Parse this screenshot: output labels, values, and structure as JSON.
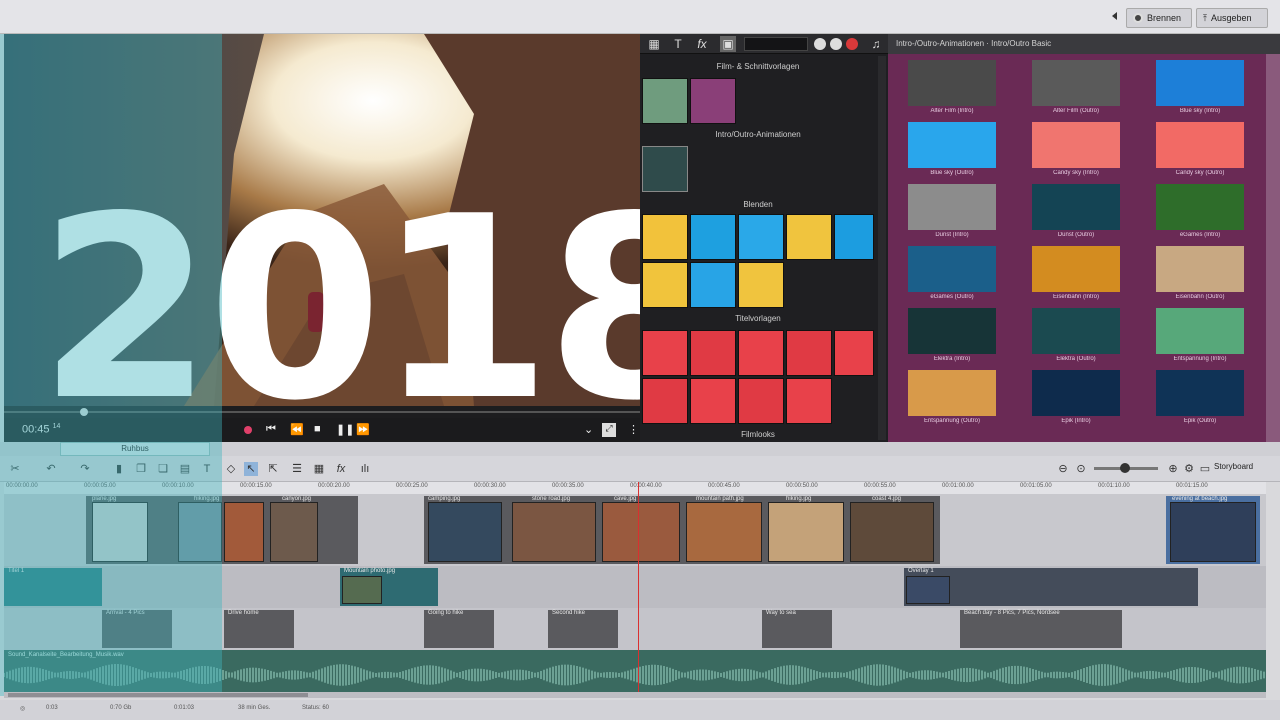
{
  "header": {
    "burn_button": "Brennen",
    "export_button": "Ausgeben"
  },
  "preview": {
    "overlay_year": "2018",
    "timecode": "00:45",
    "timecode_suffix": "14"
  },
  "library": {
    "sections": [
      "Film- & Schnittvorlagen",
      "Intro/Outro-Animationen",
      "Blenden",
      "Titelvorlagen",
      "Filmlooks"
    ],
    "icons": [
      "grid-icon",
      "title-icon",
      "fx-icon",
      "media-icon",
      "music-icon"
    ]
  },
  "template_grid": {
    "title": "Intro-/Outro-Animationen · Intro/Outro Basic",
    "items": [
      {
        "caption": "Alter Film (Intro)",
        "color": "#4a4a4a"
      },
      {
        "caption": "Alter Film (Outro)",
        "color": "#5a5a5a"
      },
      {
        "caption": "Blue sky (Intro)",
        "color": "#1d7fd8"
      },
      {
        "caption": "Blue sky (Outro)",
        "color": "#29a6ec"
      },
      {
        "caption": "Candy sky (Intro)",
        "color": "#f0756f"
      },
      {
        "caption": "Candy sky (Outro)",
        "color": "#f26a65"
      },
      {
        "caption": "Dunst (Intro)",
        "color": "#8c8c8c"
      },
      {
        "caption": "Dunst (Outro)",
        "color": "#144454"
      },
      {
        "caption": "eGames (Intro)",
        "color": "#2e6d2a"
      },
      {
        "caption": "eGames (Outro)",
        "color": "#1b5f8a"
      },
      {
        "caption": "Eisenbahn (Intro)",
        "color": "#d38c20"
      },
      {
        "caption": "Eisenbahn (Outro)",
        "color": "#c8a882"
      },
      {
        "caption": "Elektra (Intro)",
        "color": "#173437"
      },
      {
        "caption": "Elektra (Outro)",
        "color": "#1b4a50"
      },
      {
        "caption": "Entspannung (Intro)",
        "color": "#57a87a"
      },
      {
        "caption": "Entspannung (Outro)",
        "color": "#d89a4a"
      },
      {
        "caption": "Epik (Intro)",
        "color": "#0e2b4c"
      },
      {
        "caption": "Epik (Outro)",
        "color": "#0f3356"
      }
    ]
  },
  "timeline": {
    "tab_label": "Ruhbus",
    "storyboard_label": "Storyboard",
    "ruler": [
      "00:00:00.00",
      "00:00:05.00",
      "00:00:10.00",
      "00:00:15.00",
      "00:00:20.00",
      "00:00:25.00",
      "00:00:30.00",
      "00:00:35.00",
      "00:00:40.00",
      "00:00:45.00",
      "00:00:50.00",
      "00:00:55.00",
      "00:01:00.00",
      "00:01:05.00",
      "00:01:10.00",
      "00:01:15.00"
    ],
    "track1_labels": [
      "plane.jpg",
      "hiking.jpg",
      "canyon.jpg",
      "camping.jpg",
      "stone road.jpg",
      "cave.jpg",
      "mountain path.jpg",
      "hiking.jpg",
      "coast 4.jpg",
      "evening at beach.jpg"
    ],
    "track2_labels": [
      "Titel 1",
      "Mountain photo.jpg",
      "Overlay 1"
    ],
    "track3_labels": [
      "Arrival - 4 Pics",
      "Drive home",
      "Going to hike",
      "Second hike",
      "Way to sea",
      "Beach day - 8 Pics, 7 Pics, Nordsee"
    ],
    "audio_label": "Sound_Kanalseite_Bearbeitung_Musik.wav"
  },
  "status": {
    "items": [
      "0:03",
      "0:70 Gb",
      "0:01:03",
      "38 min Ges.",
      "Status: 60"
    ]
  },
  "colors": {
    "accent_teal": "#40b4be",
    "grid_bg": "#6a2a55",
    "playhead": "#d93030"
  }
}
